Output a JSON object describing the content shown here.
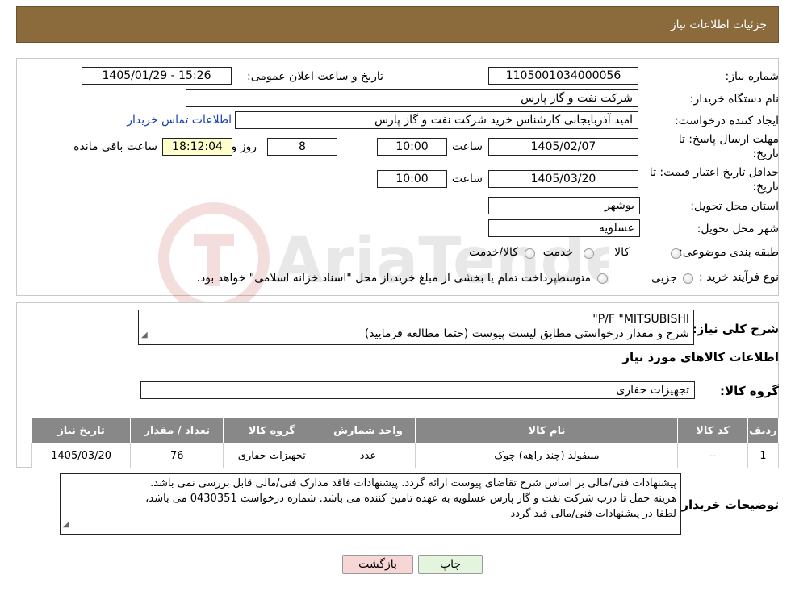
{
  "header": {
    "title": "جزئیات اطلاعات نیاز"
  },
  "form": {
    "need_number_label": "شماره نیاز:",
    "need_number": "1105001034000056",
    "announce_label": "تاریخ و ساعت اعلان عمومی:",
    "announce_value": "1405/01/29 - 15:26",
    "buyer_org_label": "نام دستگاه خریدار:",
    "buyer_org": "شرکت نفت و گاز پارس",
    "creator_label": "ایجاد کننده درخواست:",
    "creator": "امید  آذربایجانی کارشناس خرید  شرکت نفت و گاز پارس",
    "contact_link": "اطلاعات تماس خریدار",
    "deadline_label": "مهلت ارسال پاسخ: تا تاریخ:",
    "deadline_date": "1405/02/07",
    "hour_label": "ساعت",
    "deadline_time": "10:00",
    "days": "8",
    "days_label": "روز و",
    "remaining_time": "18:12:04",
    "remaining_label": "ساعت باقی مانده",
    "validity_label": "حداقل تاریخ اعتبار قیمت: تا تاریخ:",
    "validity_date": "1405/03/20",
    "validity_time": "10:00",
    "province_label": "استان محل تحویل:",
    "province": "بوشهر",
    "city_label": "شهر محل تحویل:",
    "city": "عسلویه",
    "category_label": "طبقه بندی موضوعی:",
    "cat_goods": "کالا",
    "cat_service": "خدمت",
    "cat_both": "کالا/خدمت",
    "process_label": "نوع فرآیند خرید :",
    "proc_partial": "جزیی",
    "proc_medium": "متوسط",
    "proc_note": "پرداخت تمام یا بخشی از مبلغ خرید،از محل \"اسناد خزانه اسلامی\" خواهد بود."
  },
  "summary": {
    "label": "شرح کلی نیاز:",
    "line1": "P/F \"MITSUBISHI\"",
    "line2": "شرح و مقدار درخواستی مطابق لیست پیوست (حتما مطالعه فرمایید)"
  },
  "goods": {
    "section_title": "اطلاعات کالاهای مورد نیاز",
    "group_label": "گروه کالا:",
    "group_value": "تجهیزات حفاری",
    "columns": [
      "ردیف",
      "کد کالا",
      "نام کالا",
      "واحد شمارش",
      "گروه کالا",
      "تعداد / مقدار",
      "تاریخ نیاز"
    ],
    "rows": [
      [
        "1",
        "--",
        "منیفولد (چند راهه) چوک",
        "عدد",
        "تجهیزات حفاری",
        "76",
        "1405/03/20"
      ]
    ]
  },
  "notes": {
    "label": "توضیحات خریدار:",
    "line1": "پیشنهادات فنی/مالی بر اساس شرح تقاضای پیوست ارائه گردد. پیشنهادات فاقد مدارک فنی/مالی قابل بررسی نمی باشد.",
    "line2": "هزینه حمل تا درب شرکت نفت و گاز پارس عسلویه به عهده تامین کننده می باشد. شماره درخواست 0430351 می باشد،",
    "line3": "لطفا در پیشنهادات فنی/مالی قید گردد"
  },
  "buttons": {
    "print": "چاپ",
    "back": "بازگشت"
  },
  "colors": {
    "header": "#8b6a3c",
    "table_header": "#888888",
    "back_button": "#f7d6d6",
    "print_button": "#e3f5dc",
    "timer": "#ffffcc"
  }
}
